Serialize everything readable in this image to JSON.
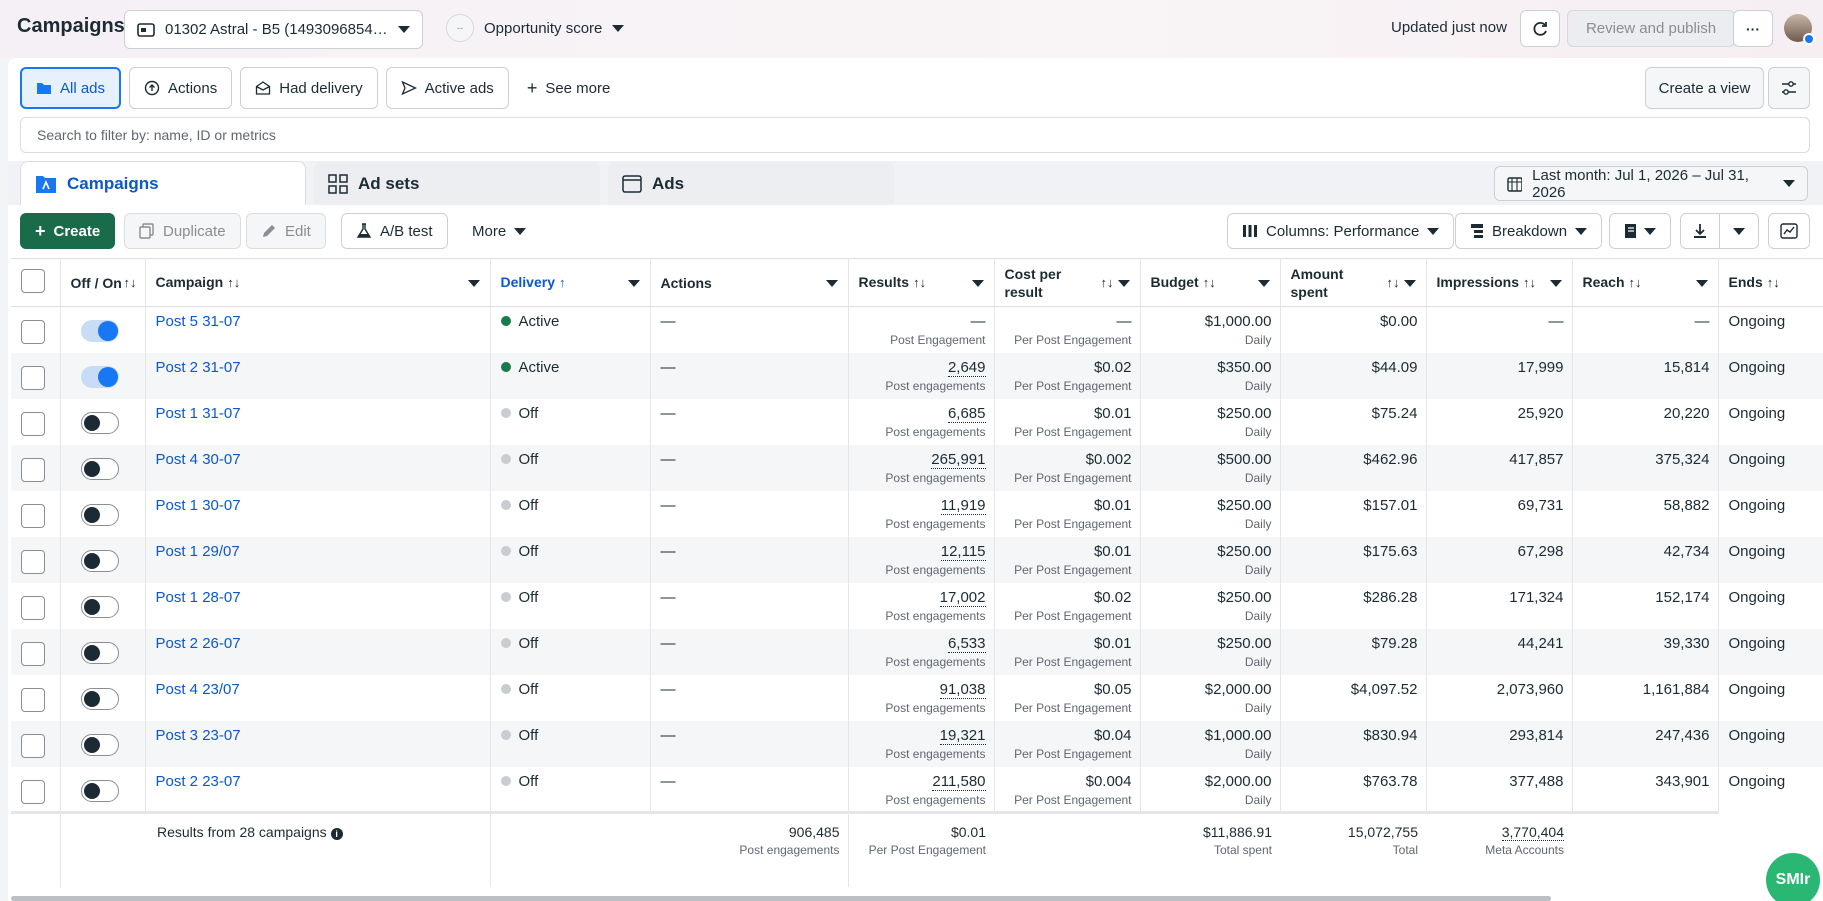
{
  "header": {
    "title": "Campaigns",
    "account": "01302 Astral - B5 (1493096854…",
    "opportunity": "Opportunity score",
    "opportunity_badge": "--",
    "updated": "Updated just now",
    "review_label": "Review and publish",
    "more_label": "···"
  },
  "views": {
    "items": [
      {
        "label": "All ads",
        "icon": "folder-icon"
      },
      {
        "label": "Actions",
        "icon": "arrow-up-circle-icon"
      },
      {
        "label": "Had delivery",
        "icon": "envelope-open-icon"
      },
      {
        "label": "Active ads",
        "icon": "send-icon"
      }
    ],
    "see_more": "See more",
    "create_view": "Create a view"
  },
  "search": {
    "placeholder": "Search to filter by: name, ID or metrics"
  },
  "tabs": [
    {
      "label": "Campaigns",
      "icon": "campaign-folder-icon"
    },
    {
      "label": "Ad sets",
      "icon": "grid-icon"
    },
    {
      "label": "Ads",
      "icon": "ad-window-icon"
    }
  ],
  "date_range": "Last month: Jul 1, 2026 – Jul 31, 2026",
  "toolbar": {
    "create": "Create",
    "duplicate": "Duplicate",
    "edit": "Edit",
    "ab_test": "A/B test",
    "more": "More",
    "columns": "Columns: Performance",
    "breakdown": "Breakdown"
  },
  "table": {
    "headers": {
      "offon": "Off / On",
      "campaign": "Campaign",
      "delivery": "Delivery",
      "actions": "Actions",
      "results": "Results",
      "cpr": "Cost per result",
      "budget": "Budget",
      "amount": "Amount spent",
      "impressions": "Impressions",
      "reach": "Reach",
      "ends": "Ends"
    },
    "rows": [
      {
        "on": true,
        "name": "Post 5 31-07",
        "delivery": "Active",
        "actions": "—",
        "results": "—",
        "results_sub": "Post Engagement",
        "cpr": "—",
        "cpr_sub": "Per Post Engagement",
        "budget": "$1,000.00",
        "budget_sub": "Daily",
        "amount": "$0.00",
        "impressions": "—",
        "reach": "—",
        "ends": "Ongoing"
      },
      {
        "on": true,
        "name": "Post 2 31-07",
        "delivery": "Active",
        "actions": "—",
        "results": "2,649",
        "results_sub": "Post engagements",
        "cpr": "$0.02",
        "cpr_sub": "Per Post Engagement",
        "budget": "$350.00",
        "budget_sub": "Daily",
        "amount": "$44.09",
        "impressions": "17,999",
        "reach": "15,814",
        "ends": "Ongoing"
      },
      {
        "on": false,
        "name": "Post 1 31-07",
        "delivery": "Off",
        "actions": "—",
        "results": "6,685",
        "results_sub": "Post engagements",
        "cpr": "$0.01",
        "cpr_sub": "Per Post Engagement",
        "budget": "$250.00",
        "budget_sub": "Daily",
        "amount": "$75.24",
        "impressions": "25,920",
        "reach": "20,220",
        "ends": "Ongoing"
      },
      {
        "on": false,
        "name": "Post 4 30-07",
        "delivery": "Off",
        "actions": "—",
        "results": "265,991",
        "results_sub": "Post engagements",
        "cpr": "$0.002",
        "cpr_sub": "Per Post Engagement",
        "budget": "$500.00",
        "budget_sub": "Daily",
        "amount": "$462.96",
        "impressions": "417,857",
        "reach": "375,324",
        "ends": "Ongoing"
      },
      {
        "on": false,
        "name": "Post 1 30-07",
        "delivery": "Off",
        "actions": "—",
        "results": "11,919",
        "results_sub": "Post engagements",
        "cpr": "$0.01",
        "cpr_sub": "Per Post Engagement",
        "budget": "$250.00",
        "budget_sub": "Daily",
        "amount": "$157.01",
        "impressions": "69,731",
        "reach": "58,882",
        "ends": "Ongoing"
      },
      {
        "on": false,
        "name": "Post 1 29/07",
        "delivery": "Off",
        "actions": "—",
        "results": "12,115",
        "results_sub": "Post engagements",
        "cpr": "$0.01",
        "cpr_sub": "Per Post Engagement",
        "budget": "$250.00",
        "budget_sub": "Daily",
        "amount": "$175.63",
        "impressions": "67,298",
        "reach": "42,734",
        "ends": "Ongoing"
      },
      {
        "on": false,
        "name": "Post 1 28-07",
        "delivery": "Off",
        "actions": "—",
        "results": "17,002",
        "results_sub": "Post engagements",
        "cpr": "$0.02",
        "cpr_sub": "Per Post Engagement",
        "budget": "$250.00",
        "budget_sub": "Daily",
        "amount": "$286.28",
        "impressions": "171,324",
        "reach": "152,174",
        "ends": "Ongoing"
      },
      {
        "on": false,
        "name": "Post 2 26-07",
        "delivery": "Off",
        "actions": "—",
        "results": "6,533",
        "results_sub": "Post engagements",
        "cpr": "$0.01",
        "cpr_sub": "Per Post Engagement",
        "budget": "$250.00",
        "budget_sub": "Daily",
        "amount": "$79.28",
        "impressions": "44,241",
        "reach": "39,330",
        "ends": "Ongoing"
      },
      {
        "on": false,
        "name": "Post 4 23/07",
        "delivery": "Off",
        "actions": "—",
        "results": "91,038",
        "results_sub": "Post engagements",
        "cpr": "$0.05",
        "cpr_sub": "Per Post Engagement",
        "budget": "$2,000.00",
        "budget_sub": "Daily",
        "amount": "$4,097.52",
        "impressions": "2,073,960",
        "reach": "1,161,884",
        "ends": "Ongoing"
      },
      {
        "on": false,
        "name": "Post 3 23-07",
        "delivery": "Off",
        "actions": "—",
        "results": "19,321",
        "results_sub": "Post engagements",
        "cpr": "$0.04",
        "cpr_sub": "Per Post Engagement",
        "budget": "$1,000.00",
        "budget_sub": "Daily",
        "amount": "$830.94",
        "impressions": "293,814",
        "reach": "247,436",
        "ends": "Ongoing"
      },
      {
        "on": false,
        "name": "Post 2 23-07",
        "delivery": "Off",
        "actions": "—",
        "results": "211,580",
        "results_sub": "Post engagements",
        "cpr": "$0.004",
        "cpr_sub": "Per Post Engagement",
        "budget": "$2,000.00",
        "budget_sub": "Daily",
        "amount": "$763.78",
        "impressions": "377,488",
        "reach": "343,901",
        "ends": "Ongoing"
      }
    ],
    "summary": {
      "label": "Results from 28 campaigns",
      "results": "906,485",
      "results_sub": "Post engagements",
      "cpr": "$0.01",
      "cpr_sub": "Per Post Engagement",
      "amount": "$11,886.91",
      "amount_sub": "Total spent",
      "impressions": "15,072,755",
      "impressions_sub": "Total",
      "reach": "3,770,404",
      "reach_sub": "Meta Accounts"
    }
  },
  "badge": "SMIr",
  "colors": {
    "accent": "#1877f2",
    "link": "#0a58ca",
    "create": "#1a6b4a",
    "active": "#1a7a4c",
    "off": "#c9ccd1"
  }
}
